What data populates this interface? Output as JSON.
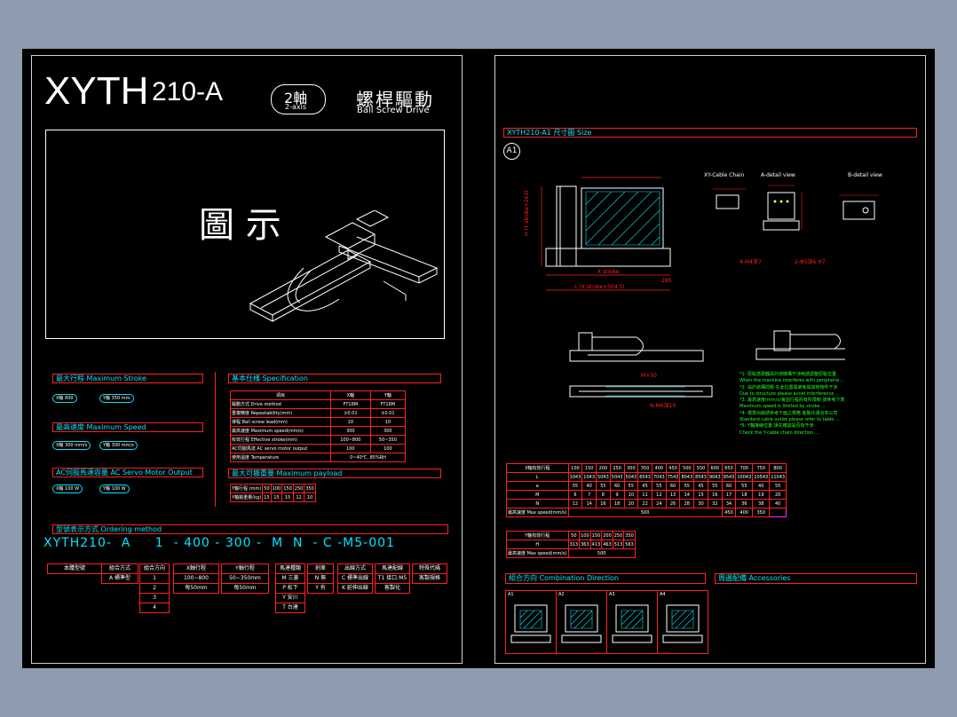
{
  "title": {
    "model": "XYTH",
    "suffix": "210-A",
    "axes_main": "2軸",
    "axes_sub": "2-axis",
    "drive_cn": "螺桿驅動",
    "drive_en": "Ball Screw Drive"
  },
  "illustration": {
    "caption": "圖 示"
  },
  "max_stroke": {
    "label": "最大行程  Maximum Stroke",
    "x": "X軸",
    "x_val": "800",
    "y": "Y軸",
    "y_val": "350 mm"
  },
  "max_speed": {
    "label": "最高速度  Maximum Speed",
    "x": "X軸",
    "x_val": "300 mm/s",
    "y": "Y軸",
    "y_val": "300 mm/s"
  },
  "motor": {
    "label": "AC伺服馬達容量  AC Servo Motor Output",
    "x": "X軸",
    "x_val": "100 W",
    "y": "Y軸",
    "y_val": "100 W"
  },
  "spec": {
    "label": "基本仕樣  Specification",
    "headers": [
      "項目",
      "X軸",
      "Y軸"
    ],
    "rows": [
      [
        "驅動方式 Drive method",
        "FT16M",
        "FT16M"
      ],
      [
        "重複精度 Repeatability(mm)",
        "±0.01",
        "±0.01"
      ],
      [
        "導程 Ball screw lead(mm)",
        "10",
        "10"
      ],
      [
        "最高速度 Maximum speed(mm/s)",
        "300",
        "300"
      ],
      [
        "有效行程 Effective stroke(mm)",
        "100~800",
        "50~350"
      ],
      [
        "AC伺服馬達 AC servo motor output",
        "100",
        "100"
      ],
      [
        "使用溫度 Temperature",
        "0~40℃, 85%RH",
        ""
      ]
    ]
  },
  "payload": {
    "label": "最大可搬重量  Maximum payload",
    "header": [
      "Y軸行程 (mm)",
      "50",
      "100",
      "150",
      "250",
      "350"
    ],
    "row_label": "Y軸搬重量(kg)",
    "values": [
      "15",
      "15",
      "15",
      "12",
      "10"
    ]
  },
  "ordering": {
    "label": "型號表示方式  Ordering method",
    "code": [
      "XYTH210",
      "-",
      "A",
      "1",
      "-",
      "400",
      "-",
      "300",
      "-",
      "M",
      "N",
      "-",
      "C",
      "-",
      "M5",
      "-",
      "001"
    ],
    "boxes": [
      {
        "head": "本體型號",
        "opts": []
      },
      {
        "head": "組合方式",
        "opts": [
          "A 標準型"
        ]
      },
      {
        "head": "組合方向",
        "opts": [
          "1",
          "2",
          "3",
          "4"
        ]
      },
      {
        "head": "X軸行程",
        "opts": [
          "100~800",
          "每50mm"
        ]
      },
      {
        "head": "Y軸行程",
        "opts": [
          "50~350mm",
          "每50mm"
        ]
      },
      {
        "head": "馬達種類",
        "opts": [
          "M 三菱",
          "P 松下",
          "Y 安川",
          "T 台達"
        ]
      },
      {
        "head": "剎車",
        "opts": [
          "N 無",
          "Y 有"
        ]
      },
      {
        "head": "出線方式",
        "opts": [
          "C 標準出線",
          "K 延伸出線"
        ]
      },
      {
        "head": "馬達配線",
        "opts": [
          "T1 接口:M5",
          "客製化"
        ]
      },
      {
        "head": "特殊代碼",
        "opts": [
          "客製規格"
        ]
      }
    ]
  },
  "size": {
    "label": "XYTH210-A1  尺寸圖 Size",
    "badge": "A1",
    "views": [
      "XY-Cable Chain",
      "A-detail view",
      "B-detail view"
    ]
  },
  "notes": [
    "*1: 原點感測器與外部機構干涉時請調整原點位置",
    "    When the machine interferes with peripheral...",
    "*2: 由於結構問題 在此位置需避免與其他物件干涉",
    "    Due to structure please avoid interference ...",
    "*3: 最高速度(mm/s)會因行程而有所限制 請參考下表",
    "    Maximum speed is limited by stroke ...",
    "*4: 標準出線請參考下面之規格 客製化請洽本公司",
    "    Standard cable outlet please refer to table ...",
    "*5: Y軸接線位置 請先確認是否有干涉",
    "    Check the Y-cable chain direction ..."
  ],
  "x_table": {
    "header": [
      "X軸有效行程",
      "100",
      "150",
      "200",
      "250",
      "300",
      "350",
      "400",
      "450",
      "500",
      "550",
      "600",
      "650",
      "700",
      "750",
      "800"
    ],
    "rows": [
      [
        "L",
        "1043",
        "1043",
        "5043",
        "5043",
        "5043",
        "6543",
        "7043",
        "7543",
        "8043",
        "8543",
        "9043",
        "9543",
        "10043",
        "10543",
        "11043"
      ],
      [
        "a",
        "55",
        "40",
        "55",
        "60",
        "55",
        "45",
        "55",
        "60",
        "55",
        "45",
        "55",
        "60",
        "55",
        "40",
        "55"
      ],
      [
        "M",
        "6",
        "7",
        "8",
        "9",
        "10",
        "11",
        "12",
        "13",
        "14",
        "15",
        "16",
        "17",
        "18",
        "19",
        "20"
      ],
      [
        "N",
        "12",
        "14",
        "16",
        "18",
        "20",
        "22",
        "24",
        "26",
        "28",
        "30",
        "32",
        "34",
        "36",
        "38",
        "40"
      ],
      [
        "最高速度 Max speed(mm/s)",
        "500",
        "",
        "",
        "",
        "",
        "",
        "",
        "",
        "",
        "",
        "",
        "",
        "450",
        "400",
        "350"
      ]
    ]
  },
  "y_table": {
    "header": [
      "Y軸有效行程",
      "50",
      "100",
      "150",
      "200",
      "250",
      "350"
    ],
    "rows": [
      [
        "H",
        "313",
        "363",
        "413",
        "463",
        "513",
        "563"
      ],
      [
        "最高速度 Max speed(mm/s)",
        "500",
        "",
        "",
        "",
        "",
        ""
      ]
    ]
  },
  "combination": {
    "label": "組合方向  Combination Direction",
    "items": [
      "A1",
      "A2",
      "A3",
      "A4"
    ]
  },
  "accessories": {
    "label": "周邊配備  Accessories"
  }
}
